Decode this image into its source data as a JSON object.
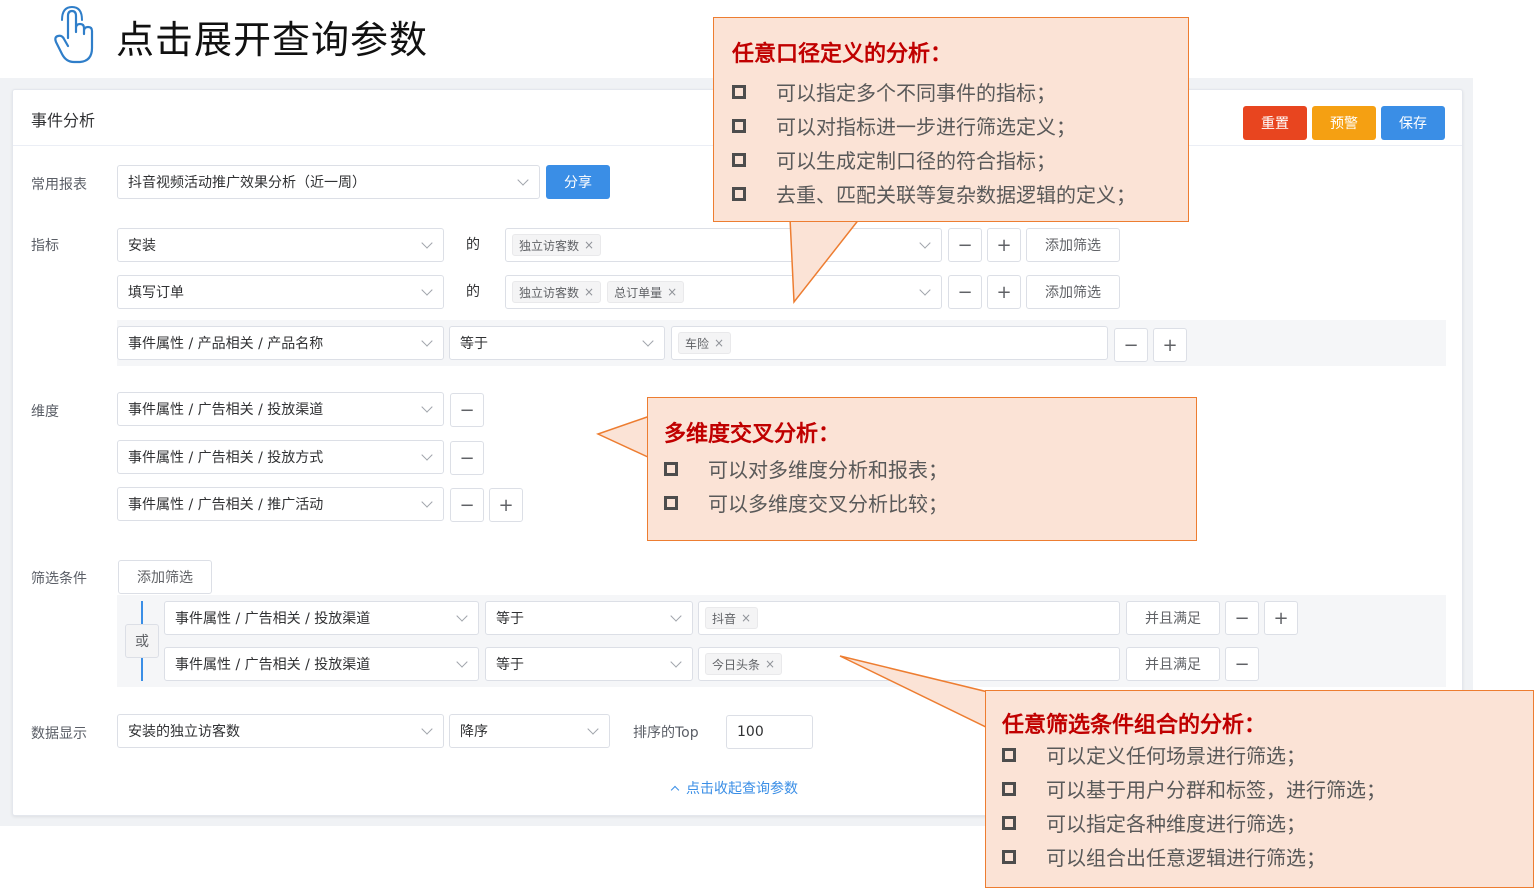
{
  "heading": {
    "title": "点击展开查询参数",
    "icon": "pointing-hand-icon"
  },
  "panel": {
    "title": "事件分析"
  },
  "header_buttons": {
    "reset": "重置",
    "alert": "预警",
    "save": "保存"
  },
  "colors": {
    "reset": "#e8451f",
    "alert": "#f5a012",
    "primary": "#3a8ee6",
    "callout_fill": "#fbe3d6",
    "callout_border": "#ed7d31",
    "callout_title": "#c00000"
  },
  "common_report": {
    "label": "常用报表",
    "value": "抖音视频活动推广效果分析（近一周）",
    "share": "分享"
  },
  "metrics": {
    "label": "指标",
    "of": "的",
    "rows": [
      {
        "event": "安装",
        "tags": [
          "独立访客数"
        ],
        "add_filter": "添加筛选"
      },
      {
        "event": "填写订单",
        "tags": [
          "独立访客数",
          "总订单量"
        ],
        "add_filter": "添加筛选"
      }
    ],
    "filter": {
      "field": "事件属性 / 产品相关 / 产品名称",
      "op": "等于",
      "tags": [
        "车险"
      ]
    }
  },
  "dimensions": {
    "label": "维度",
    "rows": [
      "事件属性 / 广告相关 / 投放渠道",
      "事件属性 / 广告相关 / 投放方式",
      "事件属性 / 广告相关 / 推广活动"
    ]
  },
  "filters": {
    "label": "筛选条件",
    "add": "添加筛选",
    "or": "或",
    "rows": [
      {
        "field": "事件属性 / 广告相关 / 投放渠道",
        "op": "等于",
        "tags": [
          "抖音"
        ],
        "and": "并且满足"
      },
      {
        "field": "事件属性 / 广告相关 / 投放渠道",
        "op": "等于",
        "tags": [
          "今日头条"
        ],
        "and": "并且满足"
      }
    ]
  },
  "display": {
    "label": "数据显示",
    "metric": "安装的独立访客数",
    "order": "降序",
    "top_label": "排序的Top",
    "top_value": "100"
  },
  "collapse": {
    "text": "点击收起查询参数"
  },
  "callouts": {
    "caliber": {
      "title": "任意口径定义的分析：",
      "items": [
        "可以指定多个不同事件的指标；",
        "可以对指标进一步进行筛选定义；",
        "可以生成定制口径的符合指标；",
        "去重、匹配关联等复杂数据逻辑的定义；"
      ]
    },
    "dimension": {
      "title": "多维度交叉分析：",
      "items": [
        "可以对多维度分析和报表；",
        "可以多维度交叉分析比较；"
      ]
    },
    "filter": {
      "title": "任意筛选条件组合的分析：",
      "items": [
        "可以定义任何场景进行筛选；",
        "可以基于用户分群和标签，进行筛选；",
        "可以指定各种维度进行筛选；",
        "可以组合出任意逻辑进行筛选；"
      ]
    }
  }
}
